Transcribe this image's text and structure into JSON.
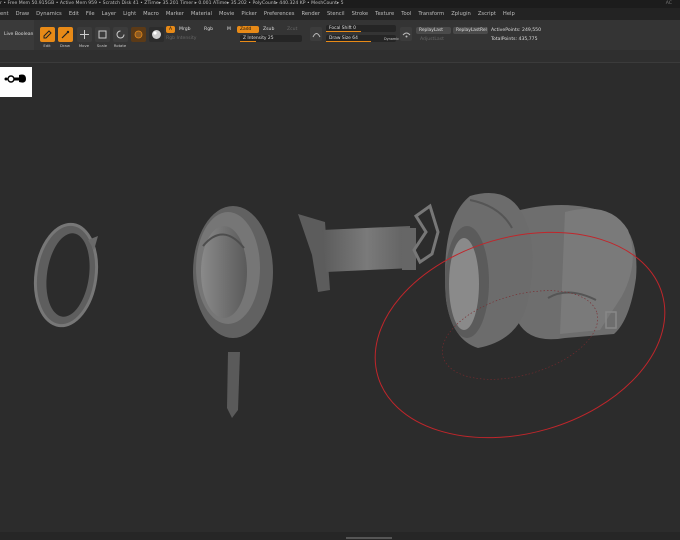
{
  "status": {
    "text": "r  • Free Mem 50.915GB • Active Mem 959 • Scratch Disk 41 • ZTime▸ 35.201 Timer ▸ 0.001 ATime▸ 35.202 • PolyCount▸ 440.324 KP • MeshCount▸ 5",
    "corner": "AC"
  },
  "menu": [
    "ent",
    "Draw",
    "Dynamics",
    "Edit",
    "File",
    "Layer",
    "Light",
    "Macro",
    "Marker",
    "Material",
    "Movie",
    "Picker",
    "Preferences",
    "Render",
    "Stencil",
    "Stroke",
    "Texture",
    "Tool",
    "Transform",
    "Zplugin",
    "Zscript",
    "Help"
  ],
  "shelf": {
    "live_boolean": "Live Boolean",
    "edit": "Edit",
    "draw": "Draw",
    "move": "Move",
    "scale": "Scale",
    "rotate": "Rotate",
    "a_btn": "A",
    "mrgb": "Mrgb",
    "rgb": "Rgb",
    "m": "M",
    "rgb_intensity": "Rgb Intensity",
    "zadd": "Zadd",
    "zsub": "Zsub",
    "zcut": "Zcut",
    "z_intensity_label": "Z Intensity",
    "z_intensity_value": "25",
    "focal_shift_label": "Focal Shift",
    "focal_shift_value": "0",
    "draw_size_label": "Draw Size",
    "draw_size_value": "64",
    "dynamic": "Dynamic",
    "replay_last": "ReplayLast",
    "replay_last_rel": "ReplayLastRel",
    "active_points": "ActivePoints: 249,550",
    "adjust_last": "AdjustLast",
    "total_points": "TotalPoints: 435,775"
  },
  "sliders": {
    "z_intensity": 0.25,
    "focal_shift": 0.5,
    "draw_size": 0.64
  },
  "colors": {
    "accent": "#e88a17",
    "brush_circle": "#c0262b",
    "mesh": "#6e6e6e"
  }
}
